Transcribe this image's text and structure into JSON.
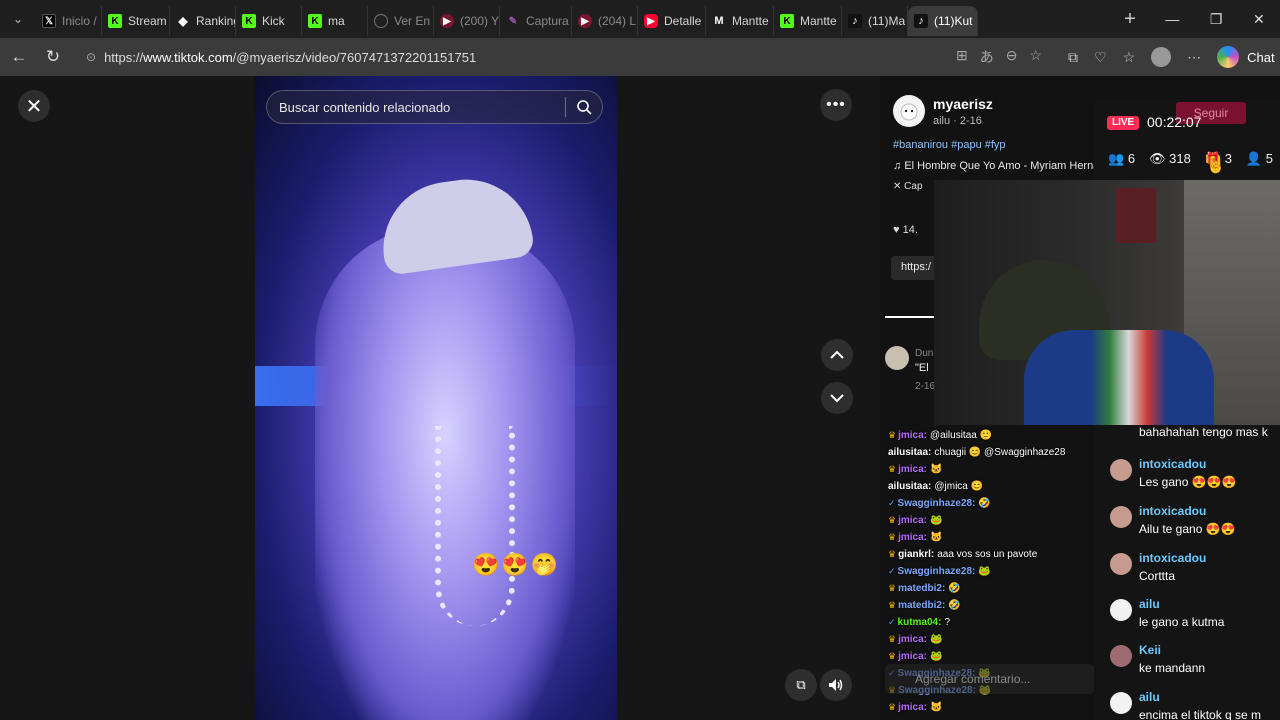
{
  "browser": {
    "tabs": [
      {
        "label": "Inicio /",
        "icon": "x-logo-icon",
        "dim": true
      },
      {
        "label": "Stream",
        "icon": "kick-logo-icon",
        "dim": false
      },
      {
        "label": "Ranking",
        "icon": "ranking-icon",
        "dim": false
      },
      {
        "label": "Kick",
        "icon": "kick-logo-icon",
        "dim": false
      },
      {
        "label": "ma",
        "icon": "kick-logo-icon",
        "dim": false
      },
      {
        "label": "Ver En",
        "icon": "globe-icon",
        "dim": true
      },
      {
        "label": "(200) Y",
        "icon": "youtube-icon",
        "dim": true
      },
      {
        "label": "Captura",
        "icon": "capture-icon",
        "dim": true
      },
      {
        "label": "(204) L",
        "icon": "youtube-icon",
        "dim": true
      },
      {
        "label": "Detalle",
        "icon": "youtube-icon",
        "dim": false
      },
      {
        "label": "Mantte",
        "icon": "mantte-icon",
        "dim": false
      },
      {
        "label": "Mantte",
        "icon": "kick-logo-icon",
        "dim": false
      },
      {
        "label": "(11)Ma",
        "icon": "tiktok-icon",
        "dim": false
      },
      {
        "label": "(11)Kut",
        "icon": "tiktok-icon",
        "dim": false
      }
    ],
    "url_prefix": "https://",
    "url_host": "www.tiktok.com",
    "url_path": "/@myaerisz/video/7607471372201151751",
    "chat_label": "Chat"
  },
  "video": {
    "search_placeholder": "Buscar contenido relacionado",
    "emojis": "😍😍🤭"
  },
  "details": {
    "author": "myaerisz",
    "author_sub": "ailu · 2-16",
    "hashtags": "#bananirou #papu #fyp",
    "music": "El Hombre Que Yo Amo - Myriam Hernández",
    "capcut": "Cap",
    "likes": "14.",
    "link": "https:/",
    "comment_user": "Dun",
    "comment_text": "\"El",
    "comment_date": "2-16"
  },
  "overlay_chat": [
    {
      "user": "jmica:",
      "text": "@ailusitaa 🙂",
      "color": "#b36bff",
      "badge": "crown"
    },
    {
      "user": "ailusitaa:",
      "text": "chuagii 😊 @Swagginhaze28",
      "color": "#ffffff",
      "badge": ""
    },
    {
      "user": "jmica:",
      "text": "🐱",
      "color": "#b36bff",
      "badge": "crown"
    },
    {
      "user": "ailusitaa:",
      "text": "@jmica 😊",
      "color": "#ffffff",
      "badge": ""
    },
    {
      "user": "Swagginhaze28:",
      "text": "🤣",
      "color": "#7aa8ff",
      "badge": "check"
    },
    {
      "user": "jmica:",
      "text": "🐸",
      "color": "#b36bff",
      "badge": "crown"
    },
    {
      "user": "jmica:",
      "text": "🐱",
      "color": "#b36bff",
      "badge": "crown"
    },
    {
      "user": "giankrl:",
      "text": "aaa vos sos un pavote",
      "color": "#ffffff",
      "badge": "crown"
    },
    {
      "user": "Swagginhaze28:",
      "text": "🐸",
      "color": "#7aa8ff",
      "badge": "check"
    },
    {
      "user": "matedbi2:",
      "text": "🤣",
      "color": "#7aa8ff",
      "badge": "crown"
    },
    {
      "user": "matedbi2:",
      "text": "🤣",
      "color": "#7aa8ff",
      "badge": "crown"
    },
    {
      "user": "kutma04:",
      "text": "?",
      "color": "#53fc18",
      "badge": "check"
    },
    {
      "user": "jmica:",
      "text": "🐸",
      "color": "#b36bff",
      "badge": "crown"
    },
    {
      "user": "jmica:",
      "text": "🐸",
      "color": "#b36bff",
      "badge": "crown"
    },
    {
      "user": "Swagginhaze28:",
      "text": "🐸",
      "color": "#7aa8ff",
      "badge": "check"
    },
    {
      "user": "Swagginhaze28:",
      "text": "🐸",
      "color": "#7aa8ff",
      "badge": "crown"
    },
    {
      "user": "jmica:",
      "text": "🐱",
      "color": "#b36bff",
      "badge": "crown"
    }
  ],
  "ghost": {
    "comment_placeholder": "Agregar comentario..."
  },
  "live": {
    "seguir": "Seguir",
    "badge": "LIVE",
    "timer": "00:22:07",
    "participants": "6",
    "viewers": "318",
    "gifts": "3",
    "extra": "5",
    "messages": [
      {
        "user": "",
        "text": "bahahahah tengo mas k",
        "avatar": ""
      },
      {
        "user": "intoxicadou",
        "text": "Les gano 😍😍😍",
        "avatar": "brown"
      },
      {
        "user": "intoxicadou",
        "text": "Ailu te gano 😍😍",
        "avatar": "brown"
      },
      {
        "user": "intoxicadou",
        "text": "Corttta",
        "avatar": "brown"
      },
      {
        "user": "ailu",
        "text": "le gano a kutma",
        "avatar": "white"
      },
      {
        "user": "Keii",
        "text": "ke mandann",
        "avatar": "pink"
      },
      {
        "user": "ailu",
        "text": "encima el tiktok q se m",
        "avatar": "white"
      }
    ]
  }
}
